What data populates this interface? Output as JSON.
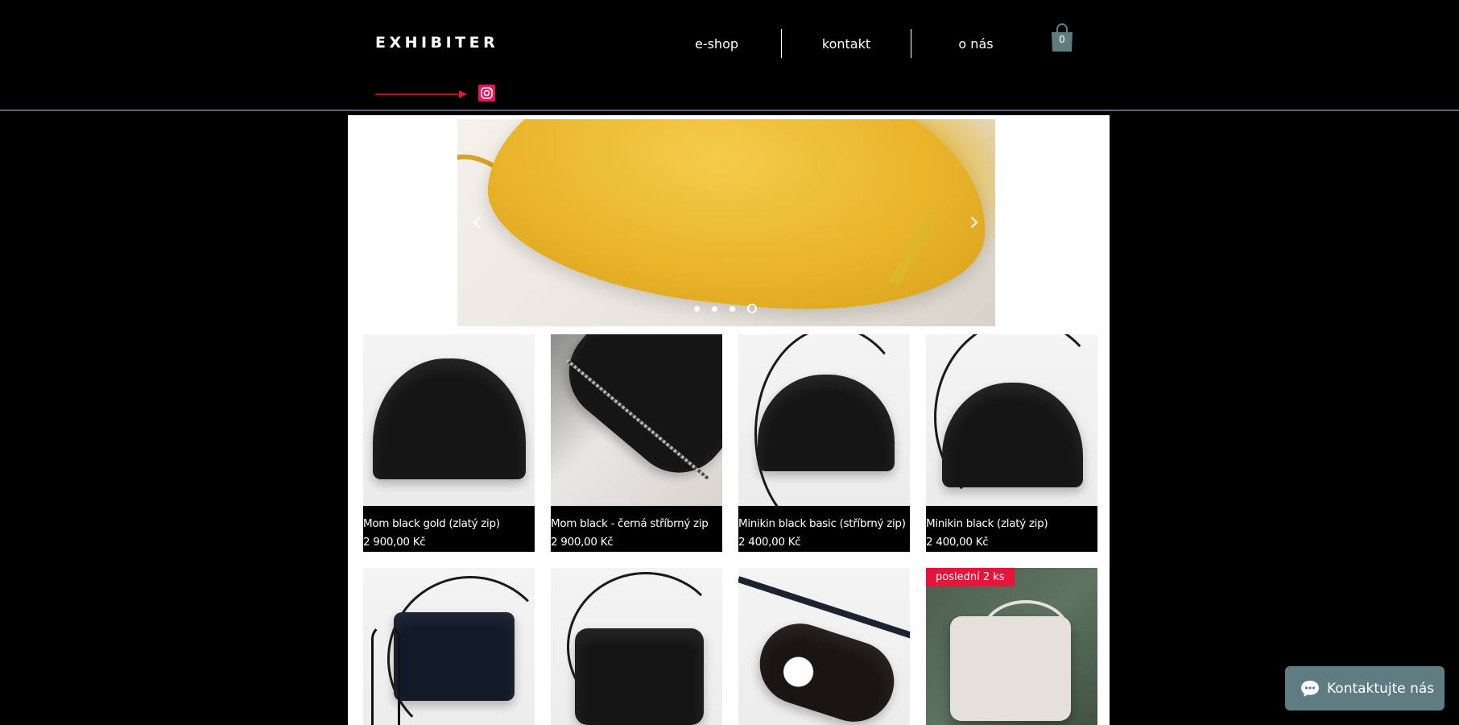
{
  "brand": {
    "logo": "EXHIBITER"
  },
  "nav": {
    "items": [
      "e-shop",
      "kontakt",
      "o nás"
    ]
  },
  "cart": {
    "count": "0",
    "icon": "shopping-bag-icon"
  },
  "social": {
    "icon": "instagram-icon",
    "accent": "#e4145d"
  },
  "slider": {
    "prev_icon": "chevron-left-icon",
    "next_icon": "chevron-right-icon",
    "dot_count": 4,
    "active_dot": 4
  },
  "products": [
    {
      "name": "Mom black gold (zlatý zip)",
      "price": "2 900,00 Kč"
    },
    {
      "name": "Mom black - černá stříbrný zip",
      "price": "2 900,00 Kč"
    },
    {
      "name": "Minikin black basic (stříbrný zip)",
      "price": "2 400,00 Kč"
    },
    {
      "name": "Minikin black (zlatý zip)",
      "price": "2 400,00 Kč"
    },
    {
      "name": "",
      "price": ""
    },
    {
      "name": "",
      "price": ""
    },
    {
      "name": "",
      "price": ""
    },
    {
      "name": "",
      "price": "",
      "ribbon": "poslední 2 ks"
    }
  ],
  "chat": {
    "label": "Kontaktujte nás",
    "icon": "chat-bubble-icon",
    "color": "#5f7d80"
  },
  "colors": {
    "ribbon": "#e4143b",
    "divider": "#5b6a72",
    "arrow": "#d3212a"
  }
}
